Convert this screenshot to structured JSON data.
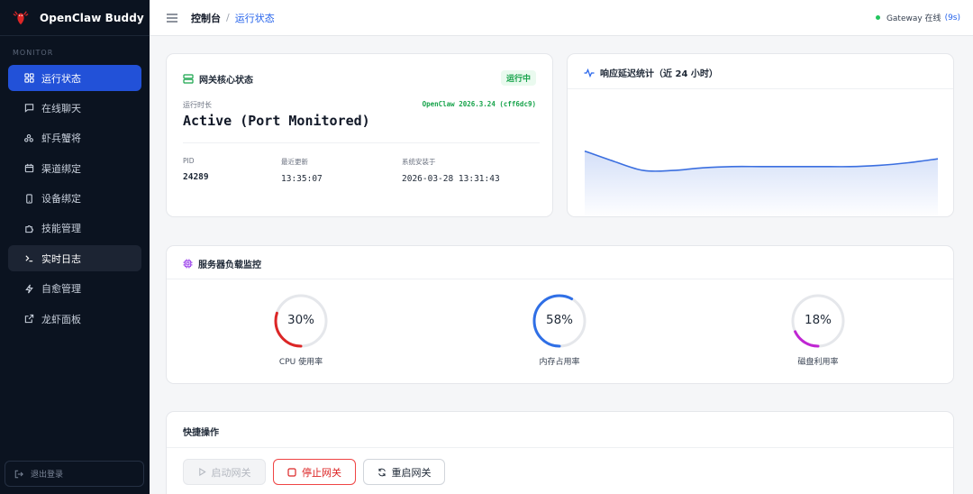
{
  "app": {
    "title": "OpenClaw Buddy"
  },
  "sidebar": {
    "section": "MONITOR",
    "items": [
      {
        "label": "运行状态",
        "icon": "grid-icon"
      },
      {
        "label": "在线聊天",
        "icon": "chat-icon"
      },
      {
        "label": "虾兵蟹将",
        "icon": "team-icon"
      },
      {
        "label": "渠道绑定",
        "icon": "calendar-icon"
      },
      {
        "label": "设备绑定",
        "icon": "device-icon"
      },
      {
        "label": "技能管理",
        "icon": "puzzle-icon"
      },
      {
        "label": "实时日志",
        "icon": "terminal-icon"
      },
      {
        "label": "自愈管理",
        "icon": "bolt-icon"
      },
      {
        "label": "龙虾面板",
        "icon": "external-link-icon"
      }
    ],
    "logout": "退出登录"
  },
  "topbar": {
    "breadcrumb_root": "控制台",
    "breadcrumb_sep": "/",
    "breadcrumb_current": "运行状态",
    "gateway_status": "Gateway 在线",
    "gateway_seconds": "(9s)"
  },
  "gateway_card": {
    "title": "网关核心状态",
    "badge": "运行中",
    "uptime_label": "运行时长",
    "version": "OpenClaw 2026.3.24 (cff6dc9)",
    "status": "Active (Port Monitored)",
    "pid_label": "PID",
    "pid": "24289",
    "updated_label": "最近更新",
    "updated": "13:35:07",
    "installed_label": "系统安装于",
    "installed": "2026-03-28 13:31:43"
  },
  "latency_card": {
    "title": "响应延迟统计（近 24 小时）"
  },
  "chart_data": {
    "type": "area",
    "title": "响应延迟统计（近 24 小时）",
    "xlabel": "",
    "ylabel": "",
    "grid": false,
    "legend": "none",
    "color": "#3b6fe0",
    "x": [
      0,
      1,
      2,
      3,
      4,
      5,
      6,
      7,
      8,
      9,
      10,
      11,
      12
    ],
    "values": [
      52,
      44,
      37,
      37,
      39,
      40,
      40,
      40,
      40,
      40,
      41,
      43,
      46
    ],
    "ylim": [
      0,
      100
    ]
  },
  "load_card": {
    "title": "服务器负载监控",
    "gauges": [
      {
        "value": 30,
        "text": "30%",
        "label": "CPU 使用率",
        "color": "#dc2626"
      },
      {
        "value": 58,
        "text": "58%",
        "label": "内存占用率",
        "color": "#2f6fe6"
      },
      {
        "value": 18,
        "text": "18%",
        "label": "磁盘利用率",
        "color": "#c026d3"
      }
    ]
  },
  "actions_card": {
    "title": "快捷操作",
    "start": "启动网关",
    "stop": "停止网关",
    "restart": "重启网关"
  }
}
